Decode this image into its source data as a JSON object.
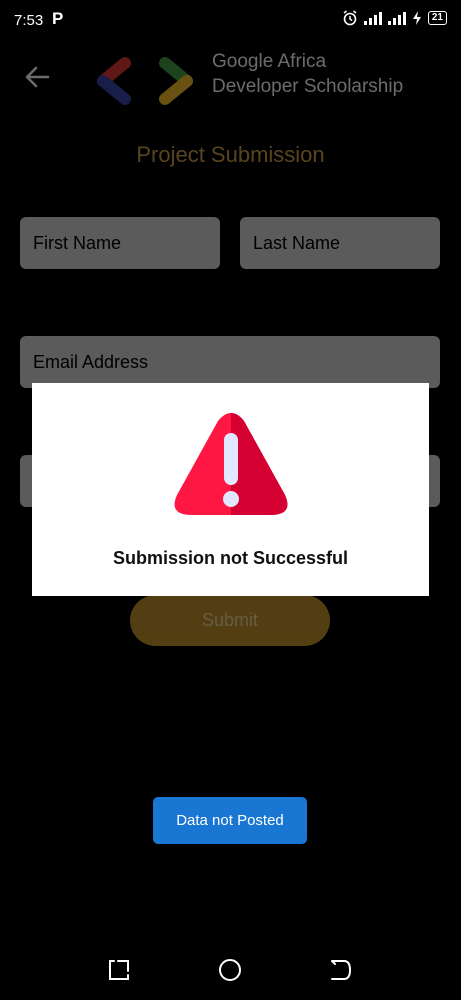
{
  "status_bar": {
    "time": "7:53",
    "app_indicator": "P",
    "battery": "21",
    "icons": [
      "alarm-icon",
      "signal-icon",
      "signal-icon",
      "charging-icon",
      "battery-icon"
    ]
  },
  "header": {
    "back_icon": "arrow-left-icon",
    "brand_line1": "Google Africa",
    "brand_line2": "Developer Scholarship",
    "logo_colors": [
      "#e53935",
      "#3949ab",
      "#43a047",
      "#fbc02d"
    ]
  },
  "page": {
    "title": "Project Submission"
  },
  "form": {
    "first_name_placeholder": "First Name",
    "last_name_placeholder": "Last Name",
    "email_placeholder": "Email Address",
    "submit_label": "Submit"
  },
  "dialog": {
    "icon": "warning-icon",
    "message": "Submission not Successful"
  },
  "toast": {
    "message": "Data not Posted",
    "color": "#1976d2"
  },
  "colors": {
    "accent": "#d1a24a",
    "warning": "#e8173a"
  }
}
